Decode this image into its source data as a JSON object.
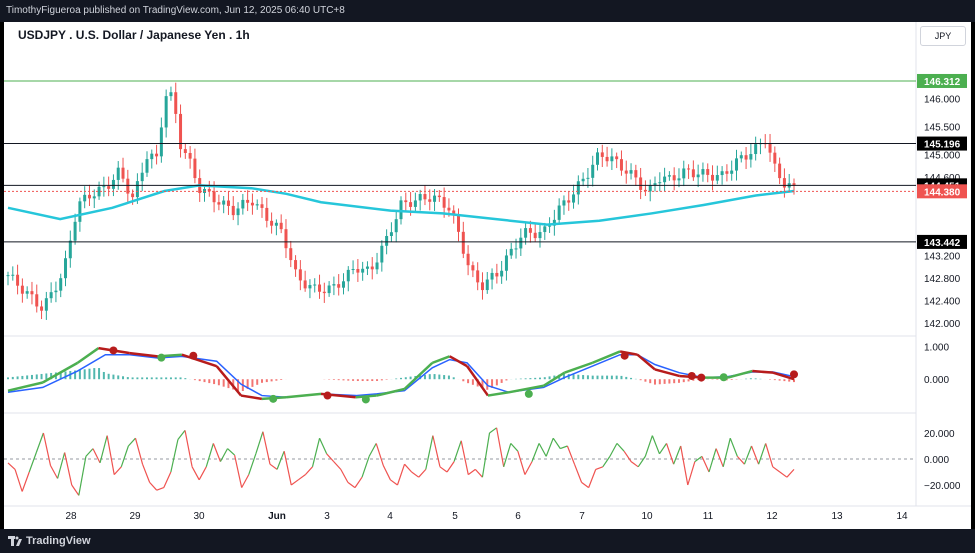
{
  "publisher": "TimothyFigueroa published on TradingView.com, Jun 12, 2025 06:40 UTC+8",
  "title": "USDJPY . U.S. Dollar / Japanese Yen . 1h",
  "currency": "JPY",
  "brand": "TradingView",
  "colors": {
    "up": "#26a69a",
    "down": "#ef5350",
    "ma": "#26c6da",
    "osc_green": "#4caf50",
    "osc_red": "#b71c1c",
    "osc_blue": "#2962ff",
    "line_green": "#4caf50",
    "line_red": "#ef5350",
    "top_level_label": "#4caf50",
    "current_label": "#ef5350",
    "level_label": "#000000"
  },
  "chart_data": [
    {
      "type": "candlestick",
      "x_ticks": [
        "28",
        "29",
        "30",
        "Jun",
        "3",
        "4",
        "5",
        "6",
        "7",
        "10",
        "11",
        "12",
        "13",
        "14"
      ],
      "y_ticks": [
        "146.000",
        "145.500",
        "145.000",
        "144.600",
        "143.200",
        "142.800",
        "142.400",
        "142.000"
      ],
      "y_range": [
        141.8,
        146.9
      ],
      "levels": [
        {
          "label": "146.312",
          "value": 146.312,
          "style": "top"
        },
        {
          "label": "145.196",
          "value": 145.196,
          "style": "level"
        },
        {
          "label": "144.451",
          "value": 144.451,
          "style": "level"
        },
        {
          "label": "143.442",
          "value": 143.442,
          "style": "level"
        }
      ],
      "current_price": {
        "label": "144.380",
        "value": 144.38
      },
      "close_path": [
        [
          0,
          142.85
        ],
        [
          1,
          142.25
        ],
        [
          1.6,
          142.9
        ],
        [
          2.0,
          144.1
        ],
        [
          2.4,
          144.3
        ],
        [
          2.8,
          144.4
        ],
        [
          3.2,
          144.7
        ],
        [
          3.6,
          144.2
        ],
        [
          4.0,
          145.0
        ],
        [
          4.3,
          144.9
        ],
        [
          4.5,
          146.1
        ],
        [
          4.75,
          146.0
        ],
        [
          4.95,
          145.2
        ],
        [
          5.2,
          144.9
        ],
        [
          5.5,
          144.4
        ],
        [
          6.2,
          144.1
        ],
        [
          6.5,
          144.0
        ],
        [
          7.0,
          144.2
        ],
        [
          7.4,
          143.9
        ],
        [
          7.9,
          143.6
        ],
        [
          8.3,
          142.8
        ],
        [
          8.8,
          142.6
        ],
        [
          9.3,
          142.6
        ],
        [
          9.7,
          142.8
        ],
        [
          10.0,
          143.0
        ],
        [
          10.4,
          142.9
        ],
        [
          10.9,
          143.5
        ],
        [
          11.3,
          144.1
        ],
        [
          11.8,
          144.2
        ],
        [
          12.2,
          144.25
        ],
        [
          12.7,
          144.05
        ],
        [
          13.0,
          143.5
        ],
        [
          13.3,
          142.9
        ],
        [
          13.6,
          142.65
        ],
        [
          14.1,
          142.9
        ],
        [
          14.4,
          143.2
        ],
        [
          14.8,
          143.6
        ],
        [
          15.4,
          143.6
        ],
        [
          15.8,
          144.0
        ],
        [
          16.1,
          144.2
        ],
        [
          16.6,
          144.6
        ],
        [
          17.0,
          145.0
        ],
        [
          17.3,
          144.95
        ],
        [
          17.6,
          144.8
        ],
        [
          18.0,
          144.6
        ],
        [
          18.4,
          144.3
        ],
        [
          18.7,
          144.6
        ],
        [
          19.0,
          144.55
        ],
        [
          19.5,
          144.7
        ],
        [
          20.0,
          144.65
        ],
        [
          20.5,
          144.6
        ],
        [
          21.0,
          144.9
        ],
        [
          21.5,
          145.1
        ],
        [
          21.8,
          145.3
        ],
        [
          22.0,
          144.8
        ],
        [
          22.3,
          144.5
        ],
        [
          22.6,
          144.38
        ]
      ],
      "ma_path": [
        [
          0,
          144.05
        ],
        [
          1.5,
          143.85
        ],
        [
          3,
          144.05
        ],
        [
          4.5,
          144.35
        ],
        [
          5.5,
          144.45
        ],
        [
          7,
          144.4
        ],
        [
          8,
          144.3
        ],
        [
          9,
          144.15
        ],
        [
          11,
          144.0
        ],
        [
          12.5,
          143.95
        ],
        [
          14,
          143.85
        ],
        [
          15.5,
          143.75
        ],
        [
          17,
          143.82
        ],
        [
          18.5,
          143.95
        ],
        [
          20,
          144.1
        ],
        [
          21.5,
          144.27
        ],
        [
          22.6,
          144.35
        ]
      ]
    },
    {
      "type": "line",
      "name": "MACD panel",
      "y_ticks": [
        "1.000",
        "0.000"
      ],
      "y_range": [
        -0.85,
        1.2
      ],
      "macd": [
        [
          0,
          -0.35
        ],
        [
          1,
          -0.1
        ],
        [
          2,
          0.5
        ],
        [
          2.6,
          0.95
        ],
        [
          3.5,
          0.8
        ],
        [
          4.3,
          0.7
        ],
        [
          5,
          0.75
        ],
        [
          6,
          0.4
        ],
        [
          6.7,
          -0.5
        ],
        [
          7.3,
          -0.6
        ],
        [
          8,
          -0.55
        ],
        [
          9,
          -0.45
        ],
        [
          10,
          -0.55
        ],
        [
          10.6,
          -0.5
        ],
        [
          11.4,
          -0.3
        ],
        [
          12.2,
          0.5
        ],
        [
          12.7,
          0.7
        ],
        [
          13.2,
          0.4
        ],
        [
          13.8,
          -0.5
        ],
        [
          14.4,
          -0.4
        ],
        [
          15.4,
          -0.2
        ],
        [
          16,
          0.2
        ],
        [
          16.8,
          0.5
        ],
        [
          17.6,
          0.85
        ],
        [
          18.1,
          0.75
        ],
        [
          18.6,
          0.3
        ],
        [
          19.3,
          0.1
        ],
        [
          20,
          0.05
        ],
        [
          20.7,
          0.05
        ],
        [
          21.4,
          0.25
        ],
        [
          22.0,
          0.2
        ],
        [
          22.6,
          0.0
        ]
      ],
      "signal": [
        [
          0,
          -0.4
        ],
        [
          1,
          -0.25
        ],
        [
          2,
          0.25
        ],
        [
          2.8,
          0.75
        ],
        [
          3.5,
          0.75
        ],
        [
          4.3,
          0.65
        ],
        [
          5,
          0.7
        ],
        [
          6,
          0.55
        ],
        [
          6.7,
          -0.15
        ],
        [
          7.3,
          -0.5
        ],
        [
          8,
          -0.55
        ],
        [
          9,
          -0.45
        ],
        [
          10,
          -0.5
        ],
        [
          10.6,
          -0.45
        ],
        [
          11.4,
          -0.35
        ],
        [
          12.2,
          0.35
        ],
        [
          12.7,
          0.6
        ],
        [
          13.2,
          0.5
        ],
        [
          13.8,
          -0.2
        ],
        [
          14.4,
          -0.4
        ],
        [
          15.4,
          -0.25
        ],
        [
          16,
          0.05
        ],
        [
          16.8,
          0.4
        ],
        [
          17.6,
          0.75
        ],
        [
          18.1,
          0.75
        ],
        [
          18.6,
          0.45
        ],
        [
          19.3,
          0.2
        ],
        [
          20,
          0.05
        ],
        [
          20.7,
          0.08
        ],
        [
          21.4,
          0.22
        ],
        [
          22.0,
          0.22
        ],
        [
          22.6,
          0.08
        ]
      ],
      "dots": [
        [
          3.3,
          0.88,
          "red"
        ],
        [
          4.8,
          0.66,
          "green"
        ],
        [
          5.8,
          0.72,
          "red"
        ],
        [
          8.3,
          -0.6,
          "green"
        ],
        [
          10.0,
          -0.5,
          "red"
        ],
        [
          11.2,
          -0.62,
          "green"
        ],
        [
          16.3,
          -0.45,
          "green"
        ],
        [
          19.3,
          0.72,
          "red"
        ],
        [
          21.4,
          0.1,
          "red"
        ],
        [
          21.7,
          0.05,
          "red"
        ],
        [
          22.4,
          0.06,
          "green"
        ],
        [
          24.6,
          0.15,
          "red"
        ]
      ]
    },
    {
      "type": "line",
      "name": "Oscillator panel",
      "y_ticks": [
        "20.000",
        "0.000",
        "−20.000"
      ],
      "y_range": [
        -30,
        30
      ],
      "values": [
        -3,
        -8,
        -25,
        -10,
        5,
        20,
        -5,
        -15,
        5,
        -20,
        -28,
        2,
        8,
        -3,
        18,
        -12,
        -6,
        10,
        16,
        -4,
        -18,
        -24,
        -22,
        -10,
        15,
        22,
        -6,
        -16,
        -6,
        12,
        -2,
        8,
        3,
        -22,
        -12,
        4,
        21,
        -4,
        -8,
        6,
        -20,
        -16,
        -12,
        -6,
        16,
        4,
        -2,
        -8,
        -18,
        -22,
        -14,
        2,
        12,
        -5,
        -16,
        -20,
        -4,
        -10,
        -14,
        -8,
        18,
        -6,
        -10,
        -2,
        14,
        -12,
        -8,
        -14,
        20,
        24,
        -6,
        12,
        6,
        -12,
        -2,
        12,
        2,
        16,
        8,
        10,
        -4,
        -18,
        -22,
        -8,
        -6,
        2,
        12,
        6,
        -2,
        -6,
        2,
        18,
        4,
        12,
        -4,
        10,
        -20,
        -2,
        2,
        -10,
        8,
        -6,
        16,
        2,
        -4,
        10,
        -4,
        12,
        -6,
        -10,
        -14,
        -8
      ]
    }
  ]
}
